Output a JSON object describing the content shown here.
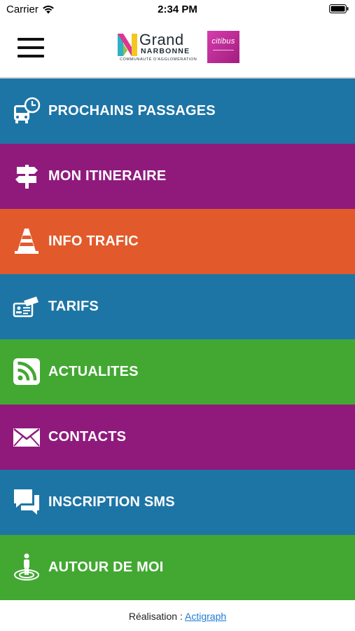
{
  "status_bar": {
    "carrier": "Carrier",
    "time": "2:34 PM"
  },
  "header": {
    "logo": {
      "grand": "Grand",
      "narbonne": "NARBONNE",
      "sub": "COMMUNAUTÉ D'AGGLOMÉRATION",
      "citibus": "citibus"
    }
  },
  "menu": {
    "items": [
      {
        "label": "PROCHAINS PASSAGES",
        "color": "#1d75a6",
        "icon": "bus-clock-icon"
      },
      {
        "label": "MON ITINERAIRE",
        "color": "#8f1a7c",
        "icon": "signpost-icon"
      },
      {
        "label": "INFO TRAFIC",
        "color": "#e25a2b",
        "icon": "traffic-cone-icon"
      },
      {
        "label": "TARIFS",
        "color": "#1d75a6",
        "icon": "ticket-card-icon"
      },
      {
        "label": "ACTUALITES",
        "color": "#42a832",
        "icon": "rss-icon"
      },
      {
        "label": "CONTACTS",
        "color": "#8f1a7c",
        "icon": "envelope-icon"
      },
      {
        "label": "INSCRIPTION SMS",
        "color": "#1d75a6",
        "icon": "chat-bubbles-icon"
      },
      {
        "label": "AUTOUR DE MOI",
        "color": "#42a832",
        "icon": "person-location-icon"
      }
    ]
  },
  "footer": {
    "prefix": "Réalisation : ",
    "link": "Actigraph"
  }
}
